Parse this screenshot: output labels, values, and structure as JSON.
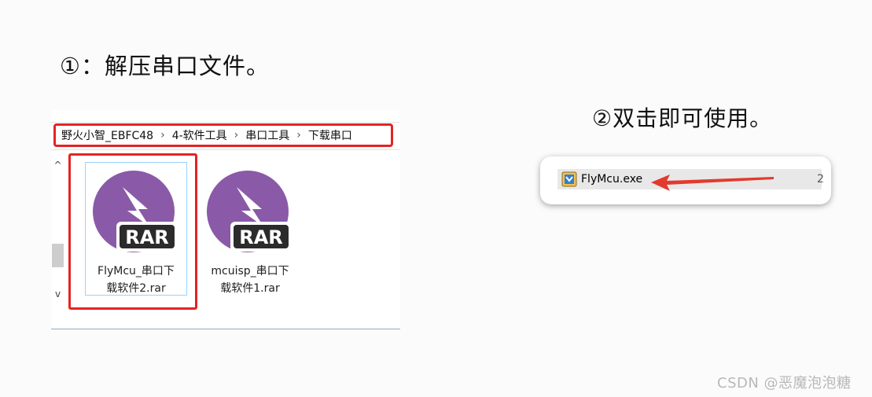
{
  "step1": "①：解压串口文件。",
  "step2": "②双击即可使用。",
  "breadcrumb": [
    "野火小智_EBFC48",
    "4-软件工具",
    "串口工具",
    "下载串口"
  ],
  "breadcrumb_separator": "›",
  "scroll": {
    "up": "^",
    "down": "v"
  },
  "files": [
    {
      "line1": "FlyMcu_串口下",
      "line2": "载软件2.rar",
      "badge": "RAR",
      "selected": true
    },
    {
      "line1": "mcuisp_串口下",
      "line2": "载软件1.rar",
      "badge": "RAR",
      "selected": false
    }
  ],
  "snippet": {
    "filename": "FlyMcu.exe",
    "trailing": "2"
  },
  "watermark": "CSDN @恶魔泡泡糖",
  "colors": {
    "highlight": "#e32424",
    "rar_purple": "#8a5aa8",
    "arrow": "#e33a2e",
    "selection": "#99d1ff"
  },
  "icons": [
    "rar-archive-icon",
    "exe-app-icon",
    "red-arrow-icon",
    "chevron-right-icon"
  ]
}
